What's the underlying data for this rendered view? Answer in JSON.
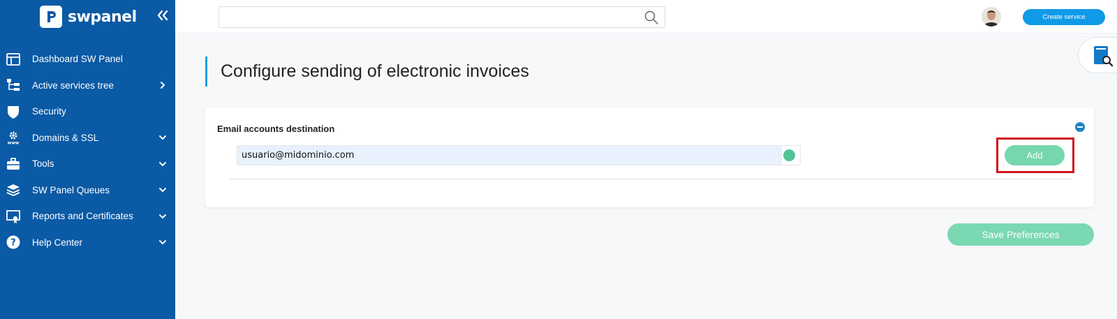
{
  "brand": {
    "name": "swpanel"
  },
  "sidebar": {
    "items": [
      {
        "label": "Dashboard SW Panel",
        "icon": "dashboard-icon",
        "caret": "none"
      },
      {
        "label": "Active services tree",
        "icon": "services-tree-icon",
        "caret": "right"
      },
      {
        "label": "Security",
        "icon": "shield-icon",
        "caret": "none"
      },
      {
        "label": "Domains & SSL",
        "icon": "www-gear-icon",
        "caret": "down"
      },
      {
        "label": "Tools",
        "icon": "toolbox-icon",
        "caret": "down"
      },
      {
        "label": "SW Panel Queues",
        "icon": "layers-icon",
        "caret": "down"
      },
      {
        "label": "Reports and Certificates",
        "icon": "certificate-icon",
        "caret": "down"
      },
      {
        "label": "Help Center",
        "icon": "help-icon",
        "caret": "down"
      }
    ]
  },
  "topbar": {
    "search_placeholder": "",
    "create_service_label": "Create service"
  },
  "page": {
    "title": "Configure sending of electronic invoices"
  },
  "card": {
    "title": "Email accounts destination",
    "email_value": "usuario@midominio.com",
    "add_label": "Add"
  },
  "actions": {
    "save_label": "Save Preferences"
  },
  "colors": {
    "sidebar_bg": "#0a5aa5",
    "accent_blue": "#1a9fe6",
    "button_green": "#76d6ad",
    "highlight_red": "#d0121b"
  }
}
